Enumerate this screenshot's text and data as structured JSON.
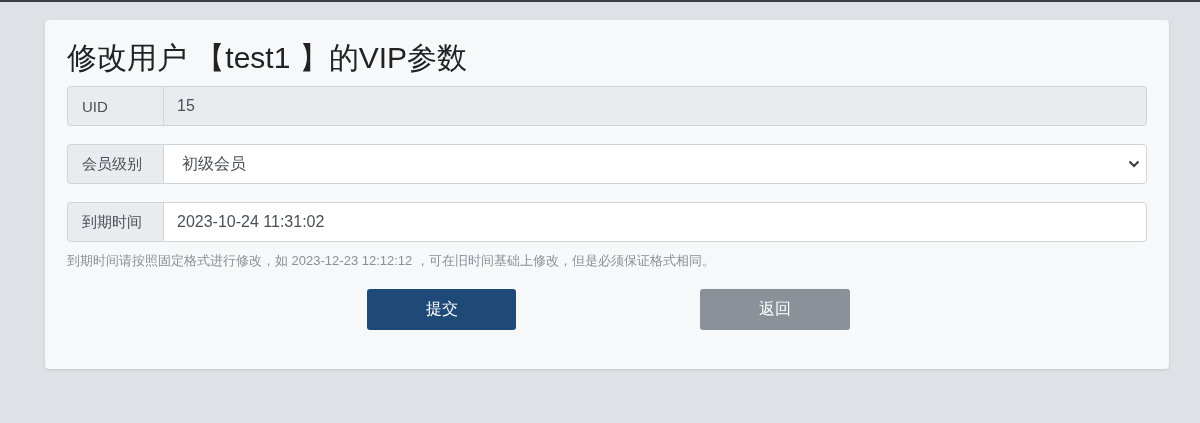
{
  "title": "修改用户 【test1 】的VIP参数",
  "fields": [
    {
      "kind": "readonly",
      "label": "UID",
      "value": "15"
    },
    {
      "kind": "select",
      "label": "会员级别",
      "value": "初级会员"
    },
    {
      "kind": "text",
      "label": "到期时间",
      "value": "2023-10-24 11:31:02"
    }
  ],
  "hint": "到期时间请按照固定格式进行修改，如 2023-12-23 12:12:12 ，可在旧时间基础上修改，但是必须保证格式相同。",
  "buttons": [
    {
      "kind": "primary",
      "label": "提交"
    },
    {
      "kind": "secondary",
      "label": "返回"
    }
  ]
}
